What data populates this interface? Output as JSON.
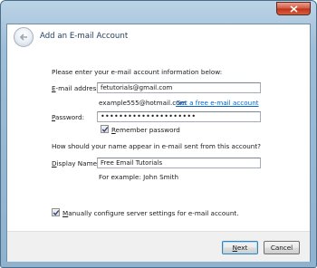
{
  "window": {
    "title": "Add an E-mail Account",
    "close_icon": "close-x-icon"
  },
  "intro": "Please enter your e-mail account information below:",
  "email": {
    "label_mnemonic": "E",
    "label_rest": "-mail address:",
    "value": "fetutorials@gmail.com",
    "example": "example555@hotmail.com",
    "free_link": "Get a free e-mail account"
  },
  "password": {
    "label_mnemonic": "P",
    "label_rest": "assword:",
    "mask": "•••••••••••••••••••••"
  },
  "remember": {
    "label_mnemonic": "R",
    "label_rest": "emember password",
    "checked": true
  },
  "question": "How should your name appear in e-mail sent from this account?",
  "display_name": {
    "label_mnemonic": "D",
    "label_rest": "isplay Name:",
    "value": "Free Email Tutorials",
    "example": "For example: John Smith"
  },
  "manual": {
    "label_mnemonic": "M",
    "label_rest": "anually configure server settings for e-mail account.",
    "checked": true
  },
  "buttons": {
    "next_mnemonic": "N",
    "next_rest": "ext",
    "cancel": "Cancel"
  }
}
